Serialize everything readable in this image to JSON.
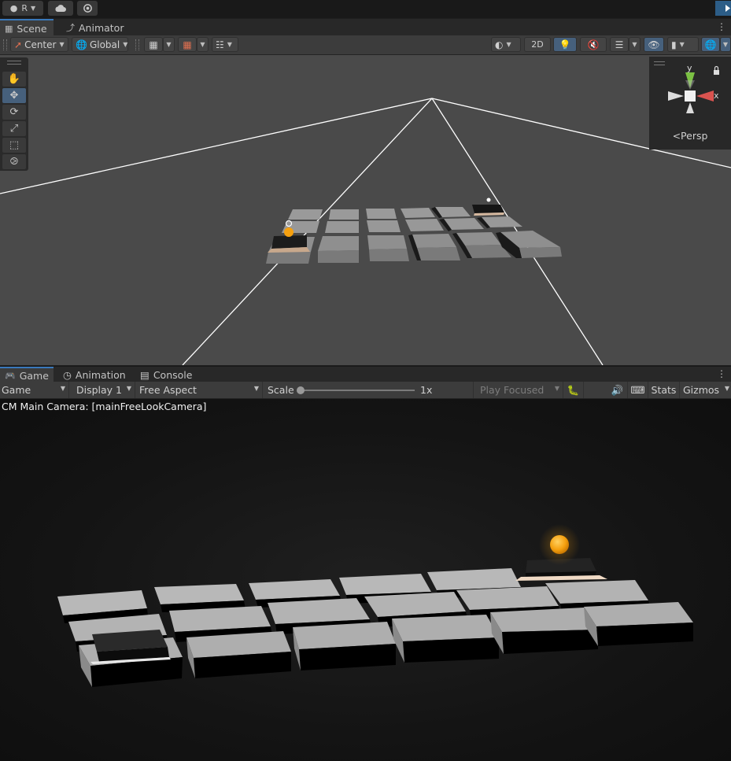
{
  "topbar": {
    "account_label": "R"
  },
  "scene_tabs": [
    {
      "label": "Scene",
      "icon": "grid-icon"
    },
    {
      "label": "Animator",
      "icon": "animator-icon"
    }
  ],
  "scene_toolbar": {
    "pivot_label": "Center",
    "space_label": "Global",
    "mode_2d_label": "2D"
  },
  "gizmo": {
    "x_label": "x",
    "y_label": "y",
    "persp_label": "Persp"
  },
  "game_tabs": [
    {
      "label": "Game",
      "icon": "gamepad-icon"
    },
    {
      "label": "Animation",
      "icon": "animation-icon"
    },
    {
      "label": "Console",
      "icon": "console-icon"
    }
  ],
  "game_toolbar": {
    "view_select": "Game",
    "display_select": "Display 1",
    "aspect_select": "Free Aspect",
    "scale_label": "Scale",
    "scale_value": "1x",
    "scale_slider_level": 0,
    "play_mode_select": "Play Focused",
    "stats_label": "Stats",
    "gizmos_label": "Gizmos"
  },
  "game_view": {
    "camera_label": "CM Main Camera: [mainFreeLookCamera]"
  },
  "colors": {
    "accent": "#3a79bb",
    "ball": "#f5a00f",
    "y_axis": "#7bc043",
    "x_axis": "#d9534f"
  }
}
